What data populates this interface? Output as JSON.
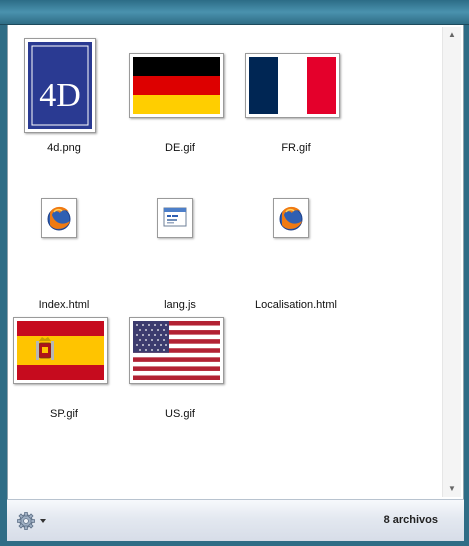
{
  "window": {
    "background_color": "#2f6d86"
  },
  "files": [
    {
      "name": "4d.png",
      "icon": "4d-logo-thumbnail"
    },
    {
      "name": "DE.gif",
      "icon": "german-flag-thumbnail"
    },
    {
      "name": "FR.gif",
      "icon": "french-flag-thumbnail"
    },
    {
      "name": "Index.html",
      "icon": "firefox-html-file-icon"
    },
    {
      "name": "lang.js",
      "icon": "javascript-file-icon"
    },
    {
      "name": "Localisation.html",
      "icon": "firefox-html-file-icon"
    },
    {
      "name": "SP.gif",
      "icon": "spanish-flag-thumbnail"
    },
    {
      "name": "US.gif",
      "icon": "us-flag-thumbnail"
    }
  ],
  "logo_4d": {
    "text": "4D"
  },
  "status_bar": {
    "item_count": "8 archivos",
    "options_icon": "gear-icon"
  },
  "scrollbar": {
    "up_arrow": "▲",
    "down_arrow": "▼"
  },
  "colors": {
    "logo_blue": "#2a3a92",
    "de_black": "#000000",
    "de_red": "#dd0000",
    "de_gold": "#ffce00",
    "fr_blue": "#002654",
    "fr_red": "#e4002b",
    "es_red": "#c60b1e",
    "es_yellow": "#ffc400",
    "us_red": "#b22234",
    "us_blue": "#3c3b6e"
  }
}
